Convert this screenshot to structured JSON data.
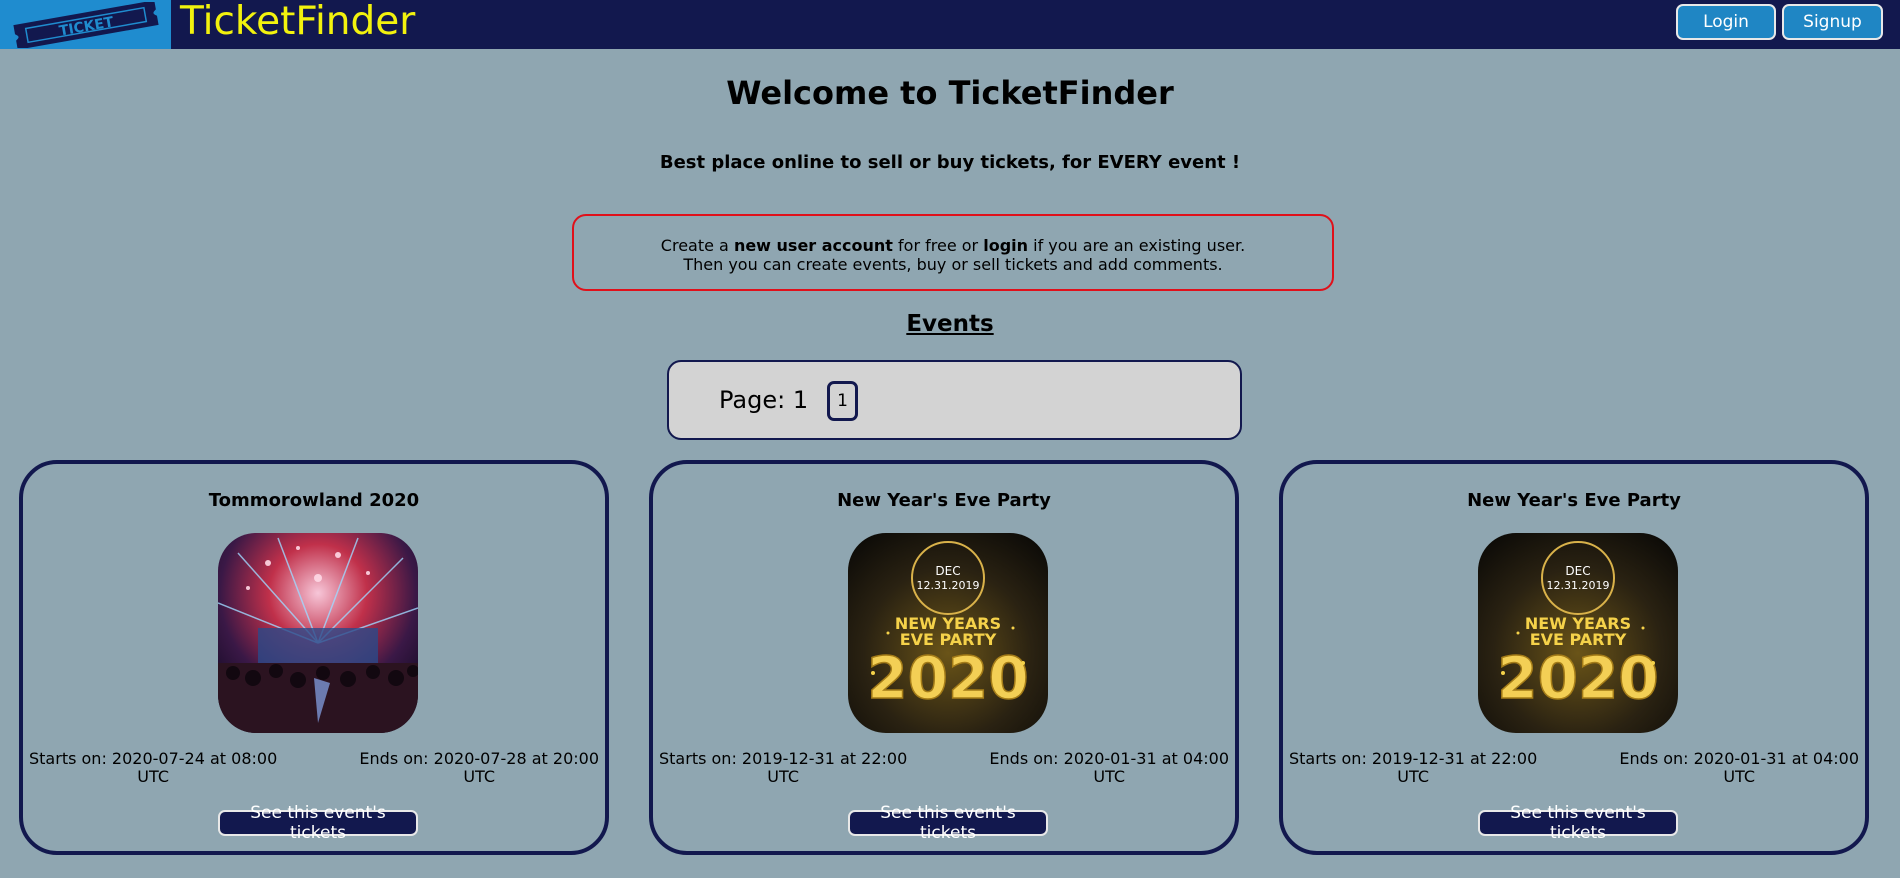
{
  "header": {
    "logo_text": "TICKET",
    "brand": "TicketFinder",
    "login_label": "Login",
    "signup_label": "Signup"
  },
  "hero": {
    "title": "Welcome to TicketFinder",
    "subtitle": "Best place online to sell or buy tickets, for EVERY event !"
  },
  "notice": {
    "line1_prefix": "Create a ",
    "line1_bold1": "new user account",
    "line1_mid": " for free or ",
    "line1_bold2": "login",
    "line1_suffix": " if you are an existing user.",
    "line2": "Then you can create events, buy or sell tickets and add comments."
  },
  "events": {
    "heading": "Events",
    "pager_label": "Page: 1",
    "pages": [
      "1"
    ],
    "items": [
      {
        "title": "Tommorowland 2020",
        "image": "concert-festival-image",
        "starts_line1": "Starts on: 2020-07-24 at 08:00",
        "starts_line2": "UTC",
        "ends_line1": "Ends on: 2020-07-28 at 20:00",
        "ends_line2": "UTC",
        "button": "See this event's tickets"
      },
      {
        "title": "New Year's Eve Party",
        "image": "new-years-poster-image",
        "starts_line1": "Starts on: 2019-12-31 at 22:00",
        "starts_line2": "UTC",
        "ends_line1": "Ends on: 2020-01-31 at 04:00",
        "ends_line2": "UTC",
        "button": "See this event's tickets"
      },
      {
        "title": "New Year's Eve Party",
        "image": "new-years-poster-image",
        "starts_line1": "Starts on: 2019-12-31 at 22:00",
        "starts_line2": "UTC",
        "ends_line1": "Ends on: 2020-01-31 at 04:00",
        "ends_line2": "UTC",
        "button": "See this event's tickets"
      }
    ]
  },
  "poster_text": {
    "dec": "DEC",
    "date": "12.31.2019",
    "line1": "NEW YEARS",
    "line2": "EVE PARTY",
    "year": "2020"
  },
  "colors": {
    "background": "#8fa6b1",
    "navbar": "#12184e",
    "brand": "#f2f20e",
    "accent": "#1f86c4",
    "notice_border": "#e0101a"
  }
}
